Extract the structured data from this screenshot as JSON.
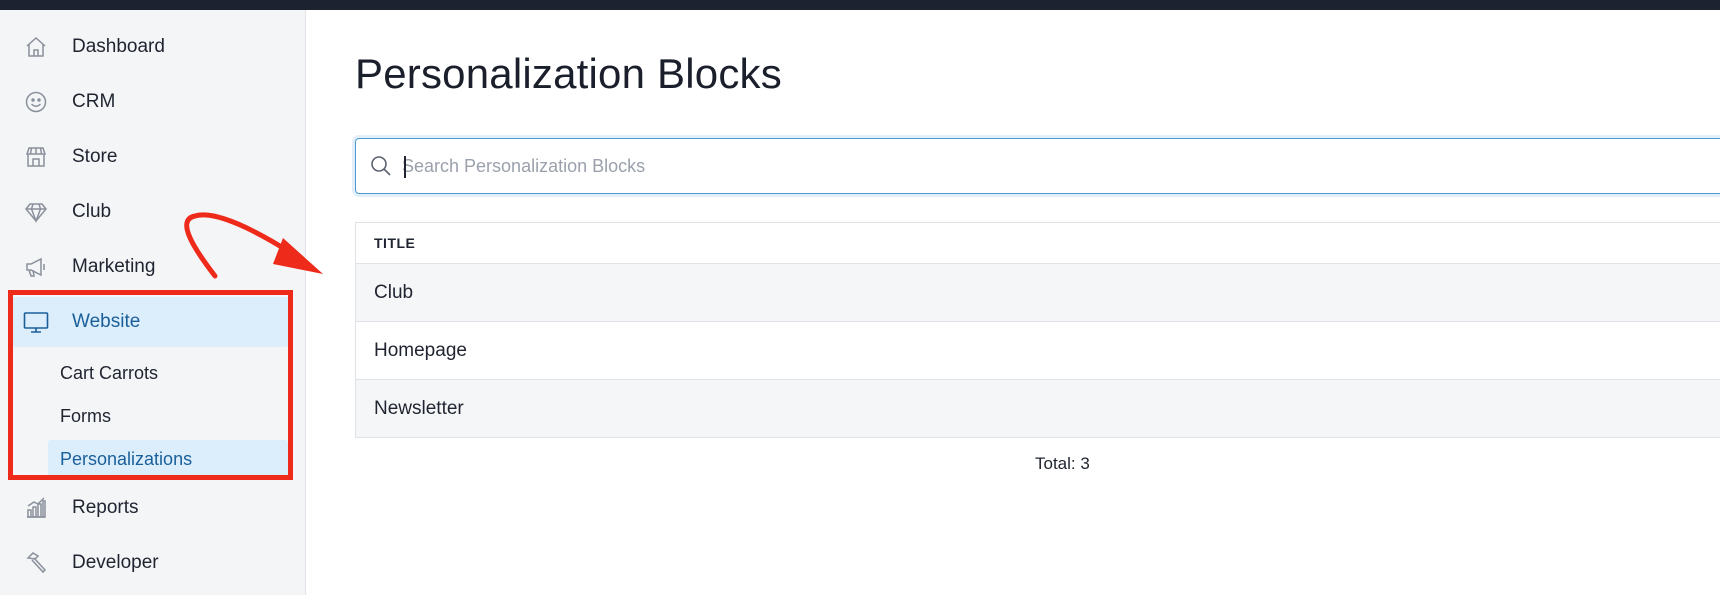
{
  "sidebar": {
    "items": [
      {
        "label": "Dashboard",
        "icon": "home-icon"
      },
      {
        "label": "CRM",
        "icon": "smiley-icon"
      },
      {
        "label": "Store",
        "icon": "store-icon"
      },
      {
        "label": "Club",
        "icon": "diamond-icon"
      },
      {
        "label": "Marketing",
        "icon": "megaphone-icon"
      },
      {
        "label": "Website",
        "icon": "monitor-icon",
        "active": true
      },
      {
        "label": "Reports",
        "icon": "bar-chart-icon"
      },
      {
        "label": "Developer",
        "icon": "hammer-icon"
      }
    ],
    "website_subitems": [
      {
        "label": "Cart Carrots"
      },
      {
        "label": "Forms"
      },
      {
        "label": "Personalizations",
        "active": true
      }
    ]
  },
  "main": {
    "title": "Personalization Blocks",
    "search": {
      "placeholder": "Search Personalization Blocks",
      "value": ""
    },
    "table": {
      "columns": [
        "TITLE"
      ],
      "rows": [
        "Club",
        "Homepage",
        "Newsletter"
      ]
    },
    "total": "Total: 3"
  },
  "colors": {
    "topbar": "#1c2230",
    "sidebar_bg": "#f4f5f7",
    "active_bg": "#dceefb",
    "active_text": "#1a5f99",
    "annotation": "#ee2a1b",
    "search_border": "#4a9ad0"
  }
}
